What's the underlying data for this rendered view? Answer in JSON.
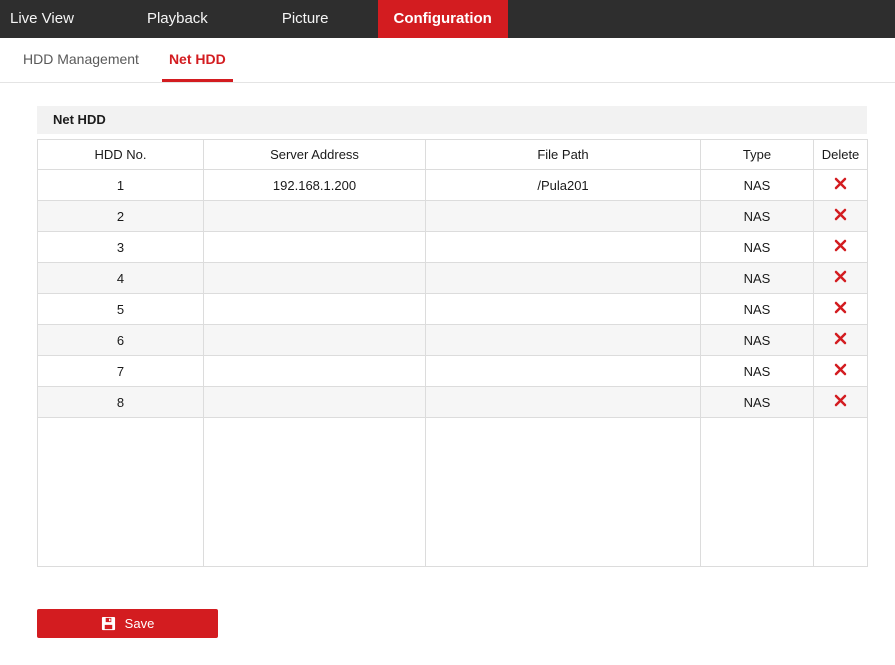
{
  "colors": {
    "accent_red": "#d31c20",
    "nav_bg": "#2e2e2e",
    "row_stripe": "#f6f6f6",
    "table_border": "#dcdcdc"
  },
  "nav": {
    "items": [
      {
        "label": "Live View",
        "active": false
      },
      {
        "label": "Playback",
        "active": false
      },
      {
        "label": "Picture",
        "active": false
      },
      {
        "label": "Configuration",
        "active": true
      }
    ]
  },
  "subnav": {
    "tabs": [
      {
        "label": "HDD Management",
        "active": false
      },
      {
        "label": "Net HDD",
        "active": true
      }
    ]
  },
  "panel": {
    "title": "Net HDD"
  },
  "table": {
    "columns": [
      "HDD No.",
      "Server Address",
      "File Path",
      "Type",
      "Delete"
    ],
    "rows": [
      {
        "hdd_no": "1",
        "server_address": "192.168.1.200",
        "file_path": "/Pula201",
        "type": "NAS",
        "delete_icon": "x-mark-icon"
      },
      {
        "hdd_no": "2",
        "server_address": "",
        "file_path": "",
        "type": "NAS",
        "delete_icon": "x-mark-icon"
      },
      {
        "hdd_no": "3",
        "server_address": "",
        "file_path": "",
        "type": "NAS",
        "delete_icon": "x-mark-icon"
      },
      {
        "hdd_no": "4",
        "server_address": "",
        "file_path": "",
        "type": "NAS",
        "delete_icon": "x-mark-icon"
      },
      {
        "hdd_no": "5",
        "server_address": "",
        "file_path": "",
        "type": "NAS",
        "delete_icon": "x-mark-icon"
      },
      {
        "hdd_no": "6",
        "server_address": "",
        "file_path": "",
        "type": "NAS",
        "delete_icon": "x-mark-icon"
      },
      {
        "hdd_no": "7",
        "server_address": "",
        "file_path": "",
        "type": "NAS",
        "delete_icon": "x-mark-icon"
      },
      {
        "hdd_no": "8",
        "server_address": "",
        "file_path": "",
        "type": "NAS",
        "delete_icon": "x-mark-icon"
      }
    ]
  },
  "save_button": {
    "label": "Save",
    "icon": "floppy-disk-icon"
  }
}
